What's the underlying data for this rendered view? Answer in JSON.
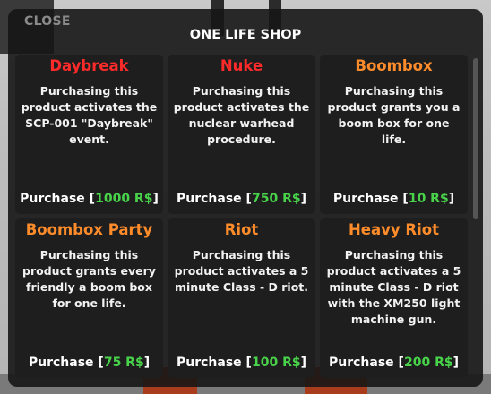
{
  "shop": {
    "close_label": "CLOSE",
    "title": "ONE LIFE SHOP",
    "purchase_label": "Purchase",
    "colors": {
      "red_name": "#ff2a2a",
      "orange_name": "#ff8c2b",
      "price": "#48d34a"
    },
    "items": [
      {
        "name": "Daybreak",
        "name_color": "#ff2a2a",
        "desc": "Purchasing this product activates the SCP-001 \"Daybreak\" event.",
        "price": "1000 R$"
      },
      {
        "name": "Nuke",
        "name_color": "#ff2a2a",
        "desc": "Purchasing this product activates the nuclear warhead procedure.",
        "price": "750 R$"
      },
      {
        "name": "Boombox",
        "name_color": "#ff8c2b",
        "desc": "Purchasing this product grants you a boom box for one life.",
        "price": "10 R$"
      },
      {
        "name": "Boombox Party",
        "name_color": "#ff8c2b",
        "desc": "Purchasing this product grants every friendly a boom box for one life.",
        "price": "75 R$"
      },
      {
        "name": "Riot",
        "name_color": "#ff8c2b",
        "desc": "Purchasing this product activates a 5 minute Class - D riot.",
        "price": "100 R$"
      },
      {
        "name": "Heavy Riot",
        "name_color": "#ff8c2b",
        "desc": "Purchasing this product activates a 5 minute Class - D riot with the XM250 light machine gun.",
        "price": "200 R$"
      }
    ]
  }
}
